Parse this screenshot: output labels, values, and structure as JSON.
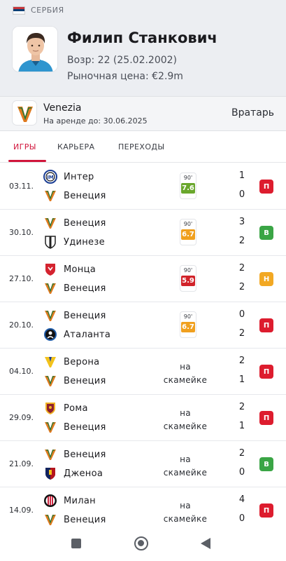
{
  "header": {
    "country": "СЕРБИЯ",
    "player_name": "Филип Станкович",
    "age": "Возр: 22 (25.02.2002)",
    "market_value": "Рыночная цена: €2.9m"
  },
  "club": {
    "name": "Venezia",
    "loan_prefix": "На аренде до:",
    "loan_date": "30.06.2025",
    "position": "Вратарь"
  },
  "tabs": [
    {
      "label": "ИГРЫ",
      "active": true
    },
    {
      "label": "КАРЬЕРА",
      "active": false
    },
    {
      "label": "ПЕРЕХОДЫ",
      "active": false
    }
  ],
  "matches": [
    {
      "date": "03.11.",
      "home": "Интер",
      "away": "Венеция",
      "home_score": "1",
      "away_score": "0",
      "played": true,
      "minutes": "90'",
      "rating": "7.6",
      "rating_color": "#6aa72d",
      "result": "П",
      "result_color": "#dd1c2e"
    },
    {
      "date": "30.10.",
      "home": "Венеция",
      "away": "Удинезе",
      "home_score": "3",
      "away_score": "2",
      "played": true,
      "minutes": "90'",
      "rating": "6.7",
      "rating_color": "#f0a01f",
      "result": "В",
      "result_color": "#3aa545"
    },
    {
      "date": "27.10.",
      "home": "Монца",
      "away": "Венеция",
      "home_score": "2",
      "away_score": "2",
      "played": true,
      "minutes": "90'",
      "rating": "5.9",
      "rating_color": "#d1232a",
      "result": "Н",
      "result_color": "#f2a823"
    },
    {
      "date": "20.10.",
      "home": "Венеция",
      "away": "Аталанта",
      "home_score": "0",
      "away_score": "2",
      "played": true,
      "minutes": "90'",
      "rating": "6.7",
      "rating_color": "#f0a01f",
      "result": "П",
      "result_color": "#dd1c2e"
    },
    {
      "date": "04.10.",
      "home": "Верона",
      "away": "Венеция",
      "home_score": "2",
      "away_score": "1",
      "played": false,
      "bench_line1": "на",
      "bench_line2": "скамейке",
      "result": "П",
      "result_color": "#dd1c2e"
    },
    {
      "date": "29.09.",
      "home": "Рома",
      "away": "Венеция",
      "home_score": "2",
      "away_score": "1",
      "played": false,
      "bench_line1": "на",
      "bench_line2": "скамейке",
      "result": "П",
      "result_color": "#dd1c2e"
    },
    {
      "date": "21.09.",
      "home": "Венеция",
      "away": "Дженоа",
      "home_score": "2",
      "away_score": "0",
      "played": false,
      "bench_line1": "на",
      "bench_line2": "скамейке",
      "result": "В",
      "result_color": "#3aa545"
    },
    {
      "date": "14.09.",
      "home": "Милан",
      "away": "Венеция",
      "home_score": "4",
      "away_score": "0",
      "played": false,
      "bench_line1": "на",
      "bench_line2": "скамейке",
      "result": "П",
      "result_color": "#dd1c2e"
    }
  ],
  "team_logos": {
    "Интер": {
      "icon": "inter-logo-icon",
      "color": "#1c3f94"
    },
    "Венеция": {
      "icon": "venezia-logo-icon",
      "color": "#e07a1f"
    },
    "Удинезе": {
      "icon": "udinese-logo-icon",
      "color": "#222222"
    },
    "Монца": {
      "icon": "monza-logo-icon",
      "color": "#d4232f"
    },
    "Аталанта": {
      "icon": "atalanta-logo-icon",
      "color": "#1e5ba8"
    },
    "Верона": {
      "icon": "verona-logo-icon",
      "color": "#f2c21b"
    },
    "Рома": {
      "icon": "roma-logo-icon",
      "color": "#8e1f2f"
    },
    "Дженоа": {
      "icon": "genoa-logo-icon",
      "color": "#b5151c"
    },
    "Милан": {
      "icon": "milan-logo-icon",
      "color": "#c8102e"
    }
  },
  "colors": {
    "accent": "#d1153b",
    "win": "#3aa545",
    "loss": "#dd1c2e",
    "draw": "#f2a823"
  }
}
